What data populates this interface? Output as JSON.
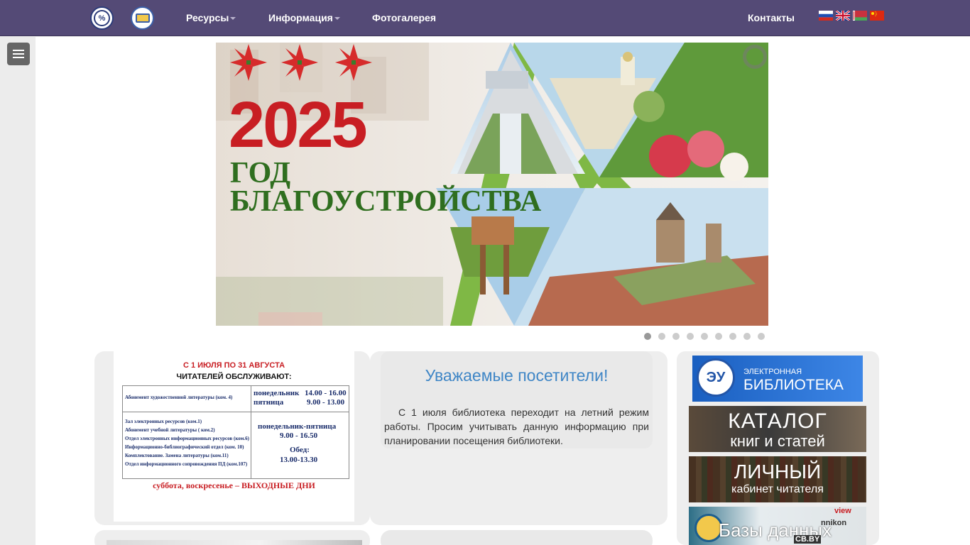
{
  "nav": {
    "resources": "Ресурсы",
    "information": "Информация",
    "gallery": "Фотогалерея",
    "contacts": "Контакты"
  },
  "banner": {
    "year": "2025",
    "line1": "ГОД",
    "line2": "БЛАГОУСТРОЙСТВА",
    "slide_count": 9,
    "active_slide": 1
  },
  "schedule": {
    "title1": "С 1 ИЮЛЯ ПО 31 АВГУСТА",
    "title2": "ЧИТАТЕЛЕЙ ОБСЛУЖИВАЮТ:",
    "row1_label": "Абонемент художественной литературы (ком. 4)",
    "row1_days": "понедельник",
    "row1_hours": "14.00 - 16.00",
    "row1_days2": "пятница",
    "row1_hours2": "9.00 - 13.00",
    "row2_items": [
      "Зал электронных ресурсов (ком.1)",
      "Абонемент учебной литературы ( ком.2)",
      "Отдел электронных информационных ресурсов (ком.6)",
      "Информационно-библиографический отдел (ком. 10)",
      "Комплектование. Замена литературы (ком.11)",
      "Отдел информационного сопровождения ПД (ком.107)"
    ],
    "row2_days": "понедельник-пятница",
    "row2_hours": "9.00 - 16.50",
    "row2_lunch_label": "Обед:",
    "row2_lunch": "13.00-13.30",
    "footer": "суббота, воскресенье – ВЫХОДНЫЕ ДНИ"
  },
  "notice": {
    "title": "Уважаемые посетители!",
    "body": "С 1 июля библиотека переходит на летний режим работы. Просим учитывать данную информацию при планировании посещения библиотеки."
  },
  "promos": {
    "elib_line1": "ЭЛЕКТРОННАЯ",
    "elib_line2": "БИБЛИОТЕКА",
    "elib_mark": "ЭУ",
    "catalog_line1": "КАТАЛОГ",
    "catalog_line2": "книг и статей",
    "cabinet_line1": "ЛИЧНЫЙ",
    "cabinet_line2": "кабинет читателя",
    "db_line1": "Базы данных",
    "db_tag_view": "view",
    "db_tag_nikon": "nnikon",
    "db_tag_cb": "CB.BY"
  },
  "logos": {
    "logo1_mark": "%"
  },
  "colors": {
    "topbar": "#544a76",
    "accent_blue": "#3f86c6",
    "red": "#c81e23",
    "green": "#2f6e1f"
  }
}
